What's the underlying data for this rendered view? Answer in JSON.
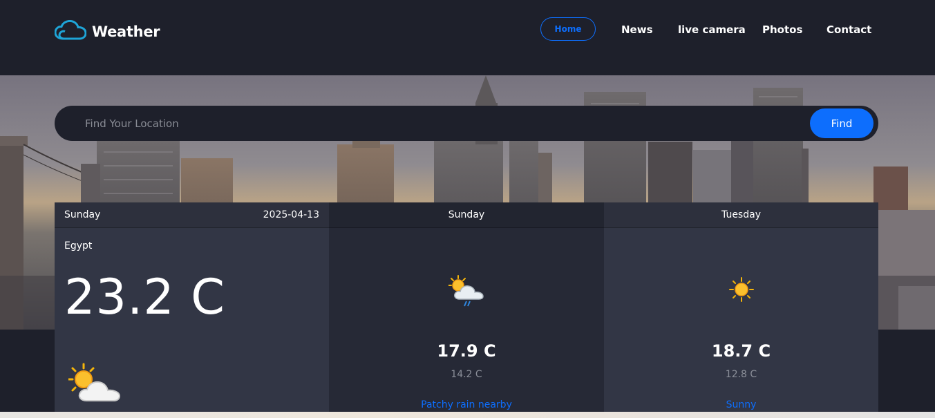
{
  "brand": {
    "name": "Weather",
    "icon": "cloud-icon",
    "accent": "#1ea5d8"
  },
  "nav": {
    "items": [
      "Home",
      "News",
      "live camera",
      "Photos",
      "Contact"
    ],
    "active": "Home"
  },
  "search": {
    "placeholder": "Find Your Location",
    "value": "",
    "button": "Find"
  },
  "today": {
    "day": "Sunday",
    "date": "2025-04-13",
    "location": "Egypt",
    "temp": "23.2 C",
    "icon": "partly-cloudy-icon"
  },
  "forecast": [
    {
      "day": "Sunday",
      "max": "17.9 C",
      "min": "14.2 C",
      "condition": "Patchy rain nearby",
      "icon": "patchy-rain-icon"
    },
    {
      "day": "Tuesday",
      "max": "18.7 C",
      "min": "12.8 C",
      "condition": "Sunny",
      "icon": "sun-icon"
    }
  ],
  "colors": {
    "background": "#1e202b",
    "card": "#323645",
    "card_alt": "#262936",
    "primary": "#0d6efd",
    "muted": "#8b8f99"
  }
}
